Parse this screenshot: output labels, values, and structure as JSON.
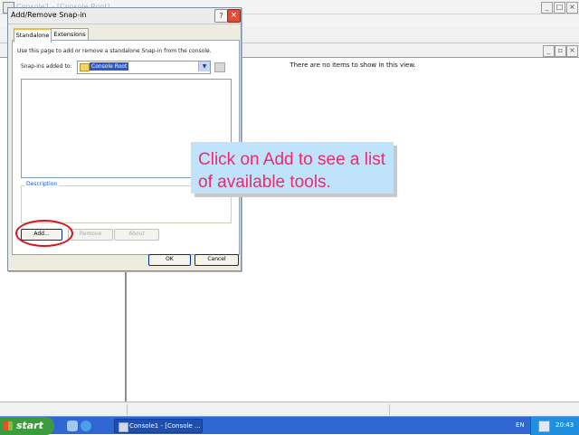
{
  "console": {
    "title": "Console1 - [Console Root]",
    "empty_message": "There are no items to show in this view."
  },
  "dialog": {
    "title": "Add/Remove Snap-in",
    "tabs": [
      {
        "label": "Standalone",
        "active": true
      },
      {
        "label": "Extensions",
        "active": false
      }
    ],
    "instruction": "Use this page to add or remove a standalone Snap-in from the console.",
    "snapins_label": "Snap-ins added to:",
    "snapins_value": "Console Root",
    "description_label": "Description",
    "buttons": {
      "add": "Add...",
      "remove": "Remove",
      "about": "About",
      "ok": "OK",
      "cancel": "Cancel"
    }
  },
  "callout": {
    "text": "Click on Add to see a list of available tools."
  },
  "taskbar": {
    "start_label": "start",
    "task_label": "Console1 - [Console ...",
    "language": "EN",
    "clock": "20:43"
  },
  "colors": {
    "callout_bg": "#bfe3fb",
    "callout_text": "#ec2b6d",
    "highlight_oval": "#d8131d",
    "taskbar": "#2f66d2",
    "start_button": "#3c9b3c"
  }
}
